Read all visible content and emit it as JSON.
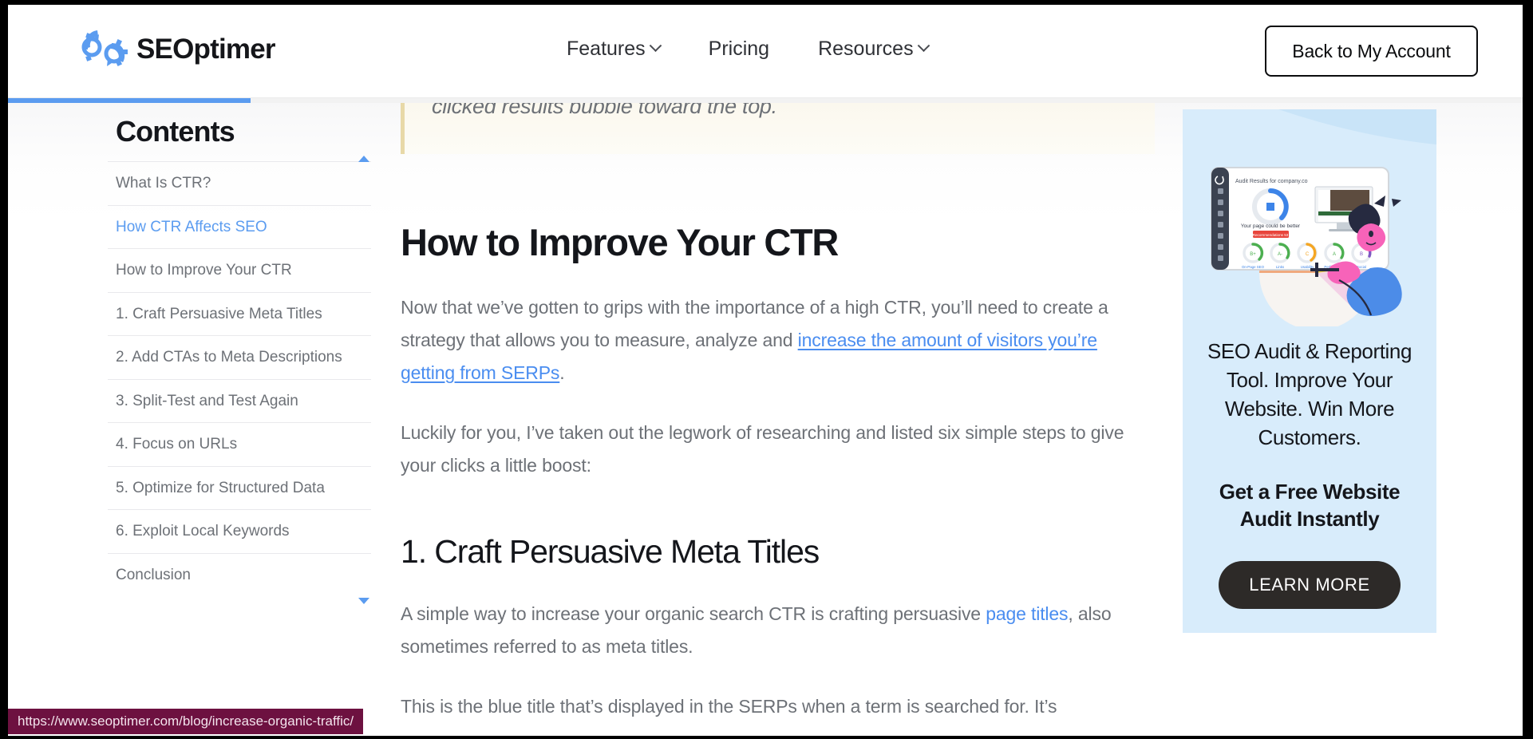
{
  "header": {
    "logo_text": "SEOptimer",
    "logo_icon": "seoptimer-gear-logo",
    "nav": [
      {
        "label": "Features",
        "has_caret": true
      },
      {
        "label": "Pricing",
        "has_caret": false
      },
      {
        "label": "Resources",
        "has_caret": true
      }
    ],
    "account_button": "Back to My Account"
  },
  "progress": {
    "percent": 16,
    "color": "#5b9cf0"
  },
  "toc": {
    "title": "Contents",
    "items": [
      {
        "label": "What Is CTR?",
        "active": false
      },
      {
        "label": "How CTR Affects SEO",
        "active": true
      },
      {
        "label": "How to Improve Your CTR",
        "active": false
      },
      {
        "label": "1. Craft Persuasive Meta Titles",
        "active": false
      },
      {
        "label": "2. Add CTAs to Meta Descriptions",
        "active": false
      },
      {
        "label": "3. Split-Test and Test Again",
        "active": false
      },
      {
        "label": "4. Focus on URLs",
        "active": false
      },
      {
        "label": "5. Optimize for Structured Data",
        "active": false
      },
      {
        "label": "6. Exploit Local Keywords",
        "active": false
      },
      {
        "label": "Conclusion",
        "active": false
      }
    ],
    "scroll_up_icon": "triangle-up-icon",
    "scroll_down_icon": "triangle-down-icon"
  },
  "article": {
    "quote_tail": "clicked results bubble toward the top.",
    "heading": "How to Improve Your CTR",
    "para1_a": "Now that we’ve gotten to grips with the importance of a high CTR, you’ll need to create a strategy that allows you to measure, analyze and ",
    "para1_link": "increase the amount of visitors you’re getting from SERPs",
    "para1_b": ".",
    "para2": "Luckily for you, I’ve taken out the legwork of researching and listed six simple steps to give your clicks a little boost:",
    "subheading": "1. Craft Persuasive Meta Titles",
    "para3_a": "A simple way to increase your organic search CTR is crafting persuasive ",
    "para3_link": "page titles",
    "para3_b": ", also sometimes referred to as meta titles.",
    "para4": "This is the blue title that’s displayed in the SERPs when a term is searched for. It’s"
  },
  "promo": {
    "illustration_icon": "seo-audit-dashboard-illustration",
    "headline": "SEO Audit & Reporting Tool. Improve Your Website. Win More Customers.",
    "subheadline": "Get a Free Website Audit Instantly",
    "cta_label": "LEARN MORE",
    "background": "#d8ecfb"
  },
  "statusbar": {
    "url": "https://www.seoptimer.com/blog/increase-organic-traffic/"
  }
}
